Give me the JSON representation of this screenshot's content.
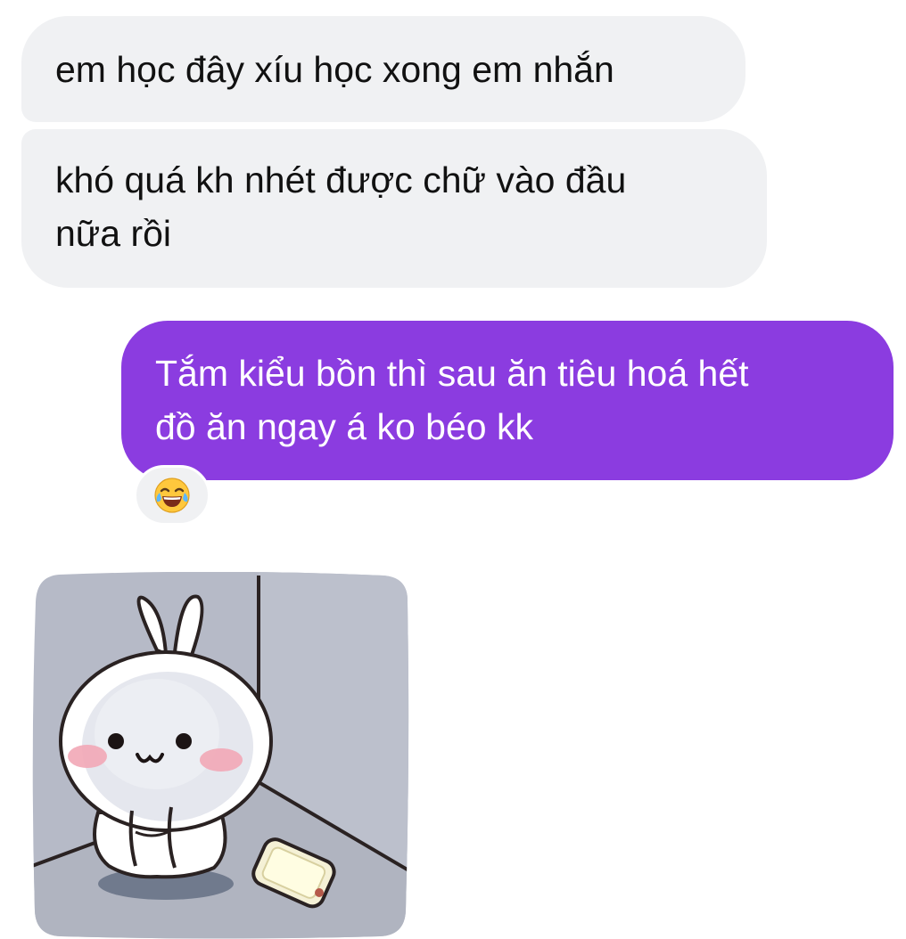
{
  "messages": [
    {
      "direction": "incoming",
      "text": "em học đây xíu học xong em nhắn"
    },
    {
      "direction": "incoming",
      "text": "khó quá kh nhét được chữ vào đầu\nnữa rồi"
    },
    {
      "direction": "outgoing",
      "text": "Tắm kiểu bồn thì sau ăn tiêu hoá hết\nđồ ăn ngay á ko béo kk",
      "reaction": "laughing-tears-emoji"
    }
  ],
  "sticker": {
    "icon": "bunny-sticker"
  },
  "colors": {
    "incoming_bubble": "#f0f1f3",
    "outgoing_bubble": "#8b3ce0",
    "incoming_text": "#111111",
    "outgoing_text": "#ffffff"
  }
}
